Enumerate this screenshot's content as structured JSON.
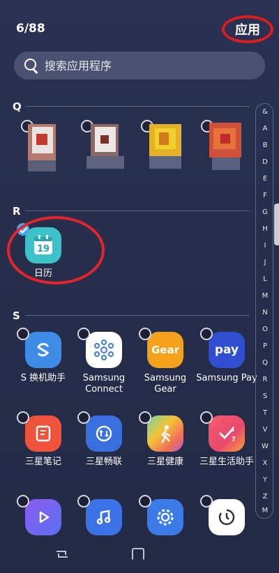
{
  "header": {
    "counter": "6/88",
    "apps_label": "应用"
  },
  "search": {
    "placeholder": "搜索应用程序"
  },
  "sections": {
    "q": "Q",
    "r": "R",
    "s": "S"
  },
  "apps_r": [
    {
      "label": "日历",
      "day": "19",
      "checked": true
    }
  ],
  "apps_s_row1": [
    {
      "label": "S 换机助手",
      "icon": "smart-switch-icon"
    },
    {
      "label": "Samsung Connect",
      "icon": "samsung-connect-icon"
    },
    {
      "label": "Samsung Gear",
      "icon": "samsung-gear-icon",
      "icon_text": "Gear"
    },
    {
      "label": "Samsung Pay",
      "icon": "samsung-pay-icon",
      "icon_text": "pay"
    }
  ],
  "apps_s_row2": [
    {
      "label": "三星笔记",
      "icon": "samsung-notes-icon"
    },
    {
      "label": "三星畅联",
      "icon": "samsung-flow-icon"
    },
    {
      "label": "三星健康",
      "icon": "samsung-health-icon"
    },
    {
      "label": "三星生活助手",
      "icon": "samsung-life-assistant-icon"
    }
  ],
  "apps_s_row3": [
    {
      "label": "",
      "icon": "video-player-icon"
    },
    {
      "label": "",
      "icon": "music-icon"
    },
    {
      "label": "",
      "icon": "settings-icon"
    },
    {
      "label": "",
      "icon": "clock-icon"
    }
  ],
  "index": [
    "&",
    "A",
    "B",
    "D",
    "E",
    "F",
    "G",
    "H",
    "I",
    "J",
    "L",
    "M",
    "N",
    "O",
    "P",
    "Q",
    "R",
    "S",
    "T",
    "V",
    "W",
    "X",
    "Y",
    "Z",
    "M"
  ],
  "colors": {
    "background": "#252d4a",
    "accent_ring": "#e8242a",
    "calendar": "#3cc2c8"
  }
}
